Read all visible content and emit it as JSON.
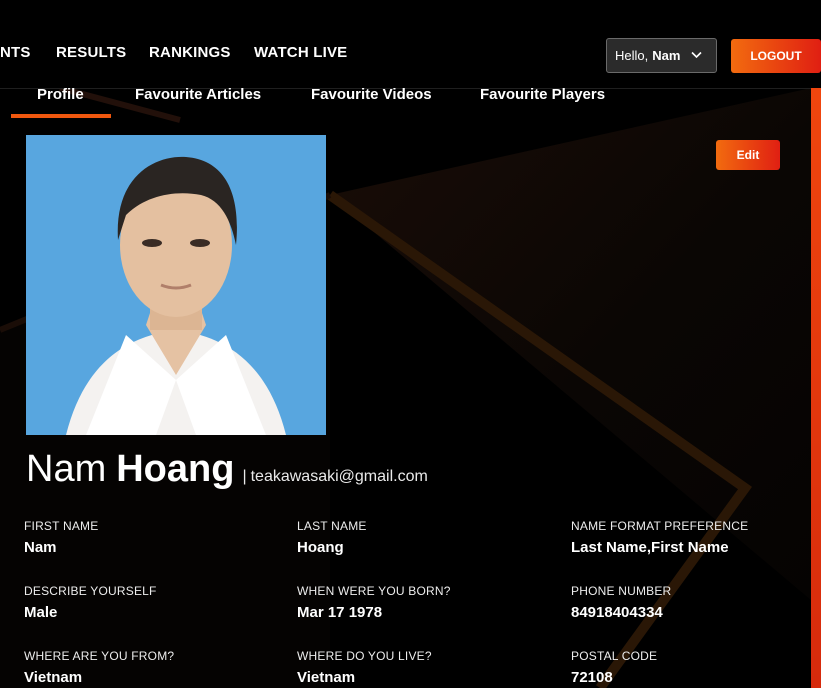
{
  "nav": {
    "items": [
      "NTS",
      "RESULTS",
      "RANKINGS",
      "WATCH LIVE"
    ]
  },
  "user_menu": {
    "greeting": "Hello,",
    "name": "Nam"
  },
  "logout_label": "LOGOUT",
  "tabs": [
    {
      "label": "Profile",
      "active": true
    },
    {
      "label": "Favourite Articles",
      "active": false
    },
    {
      "label": "Favourite Videos",
      "active": false
    },
    {
      "label": "Favourite Players",
      "active": false
    }
  ],
  "edit_label": "Edit",
  "profile": {
    "first_name": "Nam",
    "last_name": "Hoang",
    "email_separator": "|",
    "email": "teakawasaki@gmail.com"
  },
  "fields": [
    {
      "label": "FIRST NAME",
      "value": "Nam"
    },
    {
      "label": "LAST NAME",
      "value": "Hoang"
    },
    {
      "label": "NAME FORMAT PREFERENCE",
      "value": "Last Name,First Name"
    },
    {
      "label": "DESCRIBE YOURSELF",
      "value": "Male"
    },
    {
      "label": "WHEN WERE YOU BORN?",
      "value": "Mar 17 1978"
    },
    {
      "label": "PHONE NUMBER",
      "value": "84918404334"
    },
    {
      "label": "WHERE ARE YOU FROM?",
      "value": "Vietnam"
    },
    {
      "label": "WHERE DO YOU LIVE?",
      "value": "Vietnam"
    },
    {
      "label": "POSTAL CODE",
      "value": "72108"
    }
  ],
  "colors": {
    "accent_orange": "#f26b0f",
    "accent_red": "#e01f12",
    "photo_background": "#58a6df"
  }
}
